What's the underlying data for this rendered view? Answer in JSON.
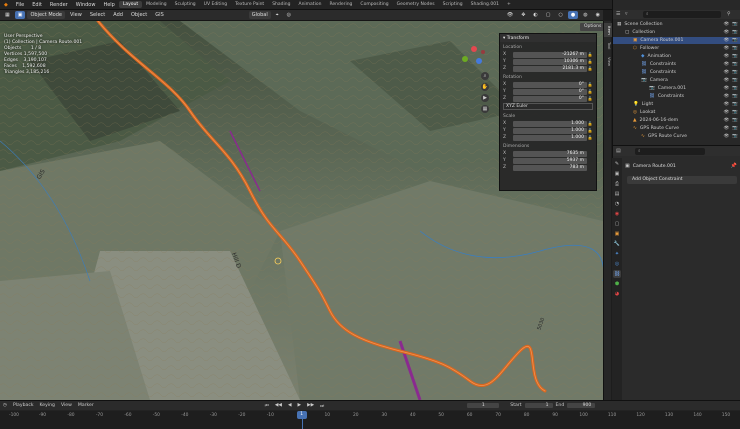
{
  "topbar": {
    "menus": [
      "File",
      "Edit",
      "Render",
      "Window",
      "Help"
    ],
    "workspaces": [
      "Layout",
      "Modeling",
      "Sculpting",
      "UV Editing",
      "Texture Paint",
      "Shading",
      "Animation",
      "Rendering",
      "Compositing",
      "Geometry Nodes",
      "Scripting",
      "Shading.001"
    ],
    "active_workspace": "Layout",
    "scene": "Scene",
    "view_layer": "ViewLayer"
  },
  "viewport_header": {
    "mode": "Object Mode",
    "menus": [
      "View",
      "Select",
      "Add",
      "Object",
      "GIS"
    ],
    "orientation": "Global",
    "options": "Options"
  },
  "hud": {
    "view_name": "User Perspective",
    "collection": "(1) Collection | Camera Route.001",
    "objects_label": "Objects",
    "objects": "1 / 8",
    "vertices_label": "Vertices",
    "vertices": "1,597,500",
    "edges_label": "Edges",
    "edges": "3,190,107",
    "faces_label": "Faces",
    "faces": "1,592,608",
    "triangles_label": "Triangles",
    "triangles": "3,185,216"
  },
  "transform": {
    "title": "Transform",
    "location_label": "Location",
    "loc": {
      "x": "-21267 m",
      "y": "10306 m",
      "z": "2181.3 m"
    },
    "rotation_label": "Rotation",
    "rot": {
      "x": "0°",
      "y": "0°",
      "z": "0°"
    },
    "rotation_mode": "XYZ Euler",
    "scale_label": "Scale",
    "scale": {
      "x": "1.000",
      "y": "1.000",
      "z": "1.000"
    },
    "dimensions_label": "Dimensions",
    "dim": {
      "x": "7635 m",
      "y": "5937 m",
      "z": "783 m"
    }
  },
  "sidebar_tabs": [
    "Item",
    "Tool",
    "View"
  ],
  "outliner": {
    "search_placeholder": "",
    "rows": [
      {
        "label": "Scene Collection",
        "indent": 0
      },
      {
        "label": "Collection",
        "indent": 1
      },
      {
        "label": "Camera Route.001",
        "indent": 2,
        "selected": true
      },
      {
        "label": "Follower",
        "indent": 2
      },
      {
        "label": "Animation",
        "indent": 3
      },
      {
        "label": "Constraints",
        "indent": 3
      },
      {
        "label": "Constraints",
        "indent": 3
      },
      {
        "label": "Camera",
        "indent": 3
      },
      {
        "label": "Camera.001",
        "indent": 4
      },
      {
        "label": "Constraints",
        "indent": 4
      },
      {
        "label": "Light",
        "indent": 2
      },
      {
        "label": "Lookat",
        "indent": 2
      },
      {
        "label": "2024-06-16-dem",
        "indent": 2
      },
      {
        "label": "GPS Route Curve",
        "indent": 2
      },
      {
        "label": "GPS Route Curve",
        "indent": 3
      }
    ]
  },
  "properties": {
    "object_name": "Camera Route.001",
    "add_constraint": "Add Object Constraint"
  },
  "timeline": {
    "menus": [
      "Playback",
      "Keying",
      "View",
      "Marker"
    ],
    "current_frame": "1",
    "start_label": "Start",
    "start": "1",
    "end_label": "End",
    "end": "900",
    "ticks": [
      "-100",
      "-90",
      "-80",
      "-70",
      "-60",
      "-50",
      "-40",
      "-30",
      "-20",
      "-10",
      "0",
      "10",
      "20",
      "30",
      "40",
      "50",
      "60",
      "70",
      "80",
      "90",
      "100",
      "110",
      "120",
      "130",
      "140",
      "150"
    ]
  },
  "map_labels": [
    "GIS",
    "Hill D",
    "5030"
  ]
}
